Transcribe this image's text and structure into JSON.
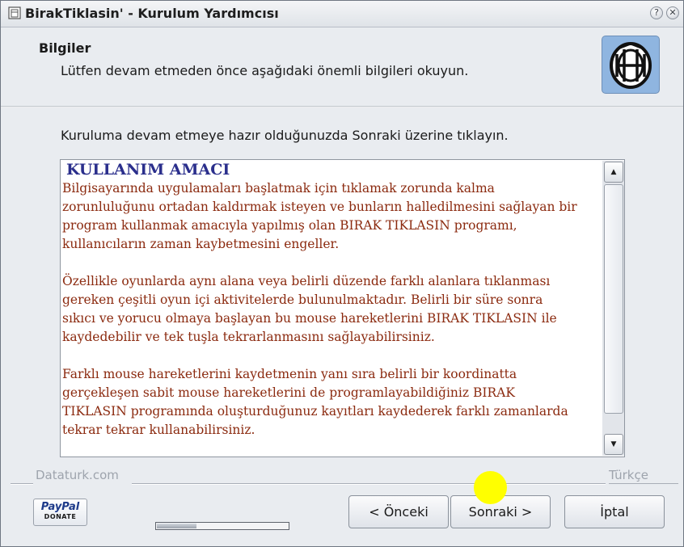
{
  "window": {
    "title": "BirakTiklasin' - Kurulum Yardımcısı",
    "controls": [
      "help",
      "minimize",
      "close"
    ]
  },
  "header": {
    "title": "Bilgiler",
    "subtitle": "Lütfen devam etmeden önce aşağıdaki önemli bilgileri okuyun.",
    "logo_icon": "app-logo-icon"
  },
  "main": {
    "instruction": "Kuruluma devam etmeye hazır olduğunuzda Sonraki üzerine tıklayın.",
    "info": {
      "heading": "KULLANIM AMACI",
      "paragraphs": [
        [
          "Bilgisayarında uygulamaları başlatmak için tıklamak zorunda kalma",
          "zorunluluğunu ortadan kaldırmak isteyen ve bunların halledilmesini sağlayan bir",
          "program kullanmak amacıyla yapılmış olan BIRAK TIKLASIN programı,",
          "kullanıcıların zaman kaybetmesini engeller."
        ],
        [
          "Özellikle oyunlarda aynı alana veya belirli düzende farklı alanlara tıklanması",
          "gereken çeşitli oyun içi aktivitelerde bulunulmaktadır. Belirli bir süre sonra",
          "sıkıcı ve yorucu olmaya başlayan bu mouse hareketlerini BIRAK TIKLASIN  ile",
          "kaydedebilir ve tek tuşla tekrarlanmasını sağlayabilirsiniz."
        ],
        [
          "Farklı mouse hareketlerini kaydetmenin yanı sıra belirli bir koordinatta",
          "gerçekleşen sabit mouse hareketlerini de programlayabildiğiniz BIRAK",
          "TIKLASIN programında oluşturduğunuz kayıtları kaydederek farklı zamanlarda",
          "tekrar tekrar kullanabilirsiniz."
        ]
      ],
      "heading_color": "#2b2f8c",
      "text_color": "#8b2a0f"
    }
  },
  "footer": {
    "brand": "Dataturk.com",
    "language": "Türkçe",
    "paypal": {
      "logo": "PayPal",
      "label": "DONATE"
    },
    "progress_fraction": 0.3,
    "buttons": {
      "back": "< Önceki",
      "next": "Sonraki >",
      "cancel": "İptal"
    }
  }
}
